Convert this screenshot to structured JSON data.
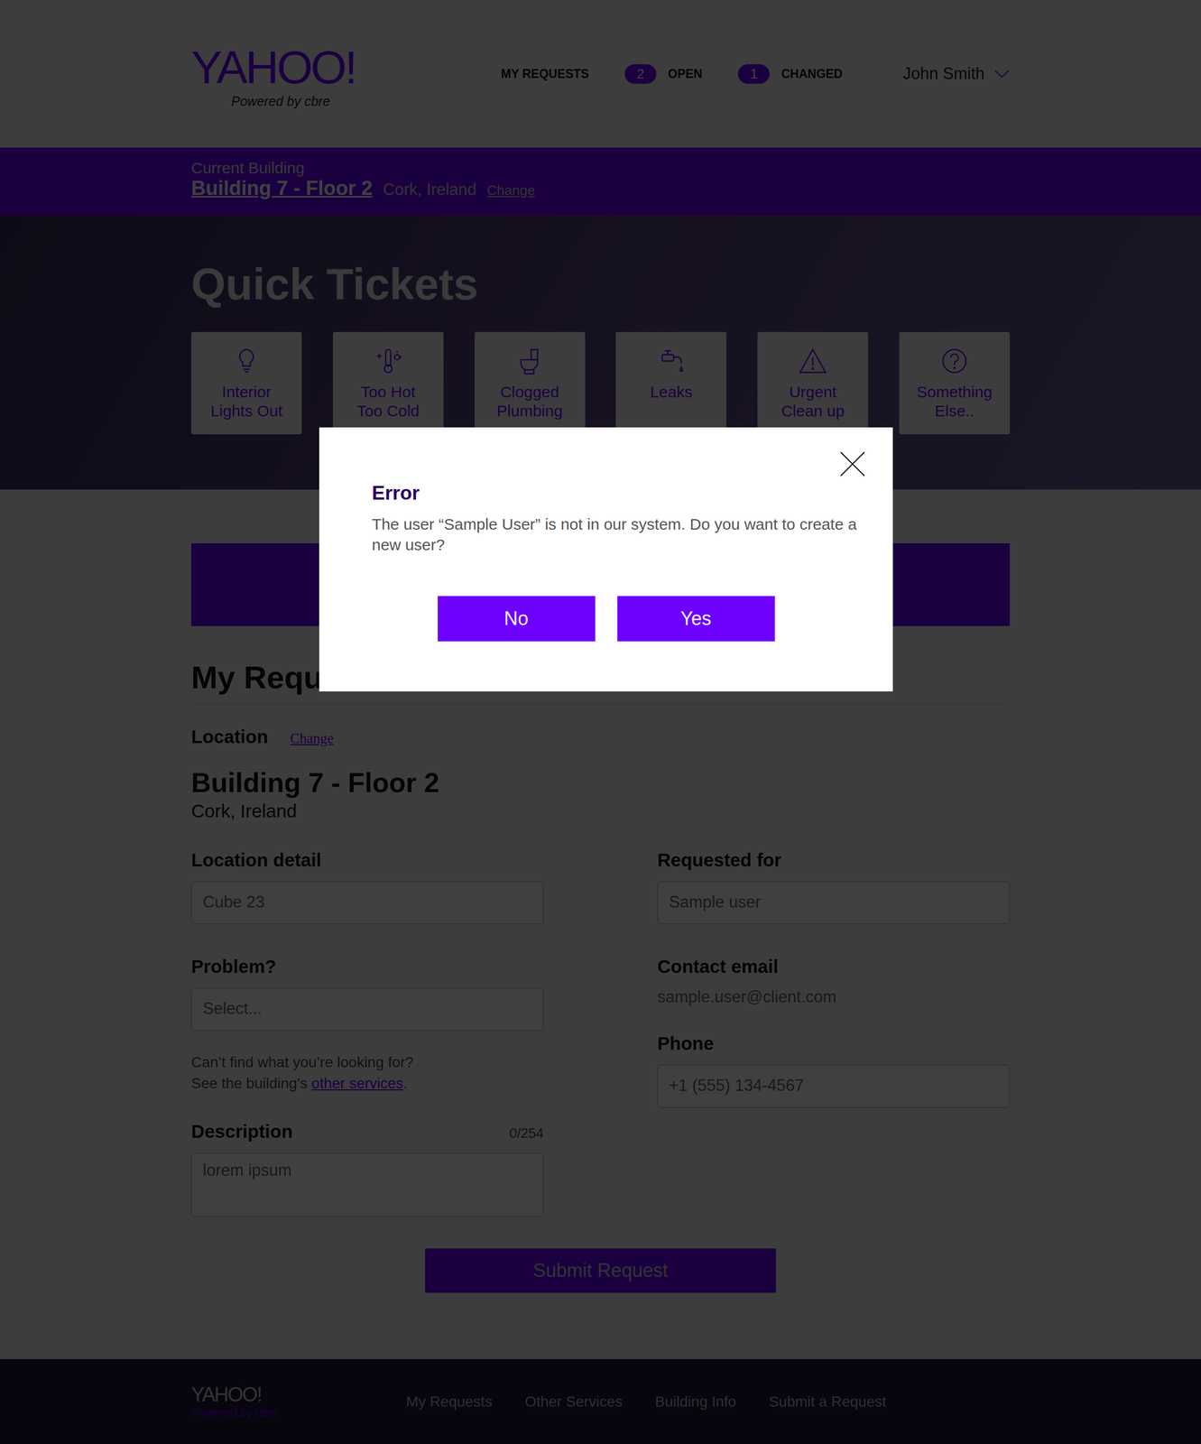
{
  "header": {
    "logo": "YAHOO!",
    "tagline": "Powered by cbre",
    "nav": {
      "label": "MY REQUESTS",
      "badges": [
        {
          "count": "2",
          "label": "OPEN"
        },
        {
          "count": "1",
          "label": "CHANGED"
        }
      ]
    },
    "user": "John Smith"
  },
  "building_bar": {
    "caption": "Current Building",
    "name": "Building 7 - Floor 2",
    "city": "Cork, Ireland",
    "link": "Change"
  },
  "quick_tickets": {
    "title": "Quick Tickets",
    "tiles": [
      {
        "lines": [
          "Interior",
          "Lights Out"
        ]
      },
      {
        "lines": [
          "Too Hot",
          "Too Cold"
        ]
      },
      {
        "lines": [
          "Clogged",
          "Plumbing"
        ]
      },
      {
        "lines": [
          "Leaks"
        ]
      },
      {
        "lines": [
          "Urgent",
          "Clean up"
        ]
      },
      {
        "lines": [
          "Something",
          "Else.."
        ]
      }
    ]
  },
  "request_form": {
    "heading": "My Requ",
    "location_label": "Location",
    "location_link": "Change",
    "building": "Building 7 - Floor 2",
    "city": "Cork, Ireland",
    "location_detail": {
      "label": "Location detail",
      "value": "Cube 23"
    },
    "problem": {
      "label": "Problem?",
      "value": "Select..."
    },
    "help": {
      "line1": "Can’t find what you’re looking for?",
      "line2": "See the building’s ",
      "link": "other services",
      "end": "."
    },
    "description": {
      "label": "Description",
      "counter": "0/254",
      "value": "lorem ipsum"
    },
    "requested_for": {
      "label": "Requested for",
      "value": "Sample user"
    },
    "contact_email": {
      "label": "Contact email",
      "value": "sample.user@client.com"
    },
    "phone": {
      "label": "Phone",
      "value": "+1 (555) 134-4567"
    },
    "submit": "Submit Request"
  },
  "footer": {
    "logo": "YAHOO!",
    "tagline": "Powered by cbre",
    "links": [
      "My Requests",
      "Other Services",
      "Building Info",
      "Submit a Request"
    ]
  },
  "modal": {
    "title": "Error",
    "message": "The user “Sample User” is not in our system. Do you want to create a new user?",
    "buttons": [
      "No",
      "Yes"
    ]
  }
}
